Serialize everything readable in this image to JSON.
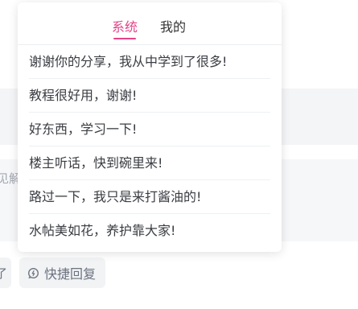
{
  "background": {
    "input_placeholder": "见解",
    "partial_button_label": "了",
    "quick_reply_label": "快捷回复"
  },
  "popup": {
    "tabs": [
      {
        "label": "系统",
        "active": true
      },
      {
        "label": "我的",
        "active": false
      }
    ],
    "replies": [
      "谢谢你的分享，我从中学到了很多!",
      "教程很好用，谢谢!",
      "好东西，学习一下!",
      "楼主听话，快到碗里来!",
      "路过一下，我只是来打酱油的!",
      "水帖美如花，养护靠大家!"
    ]
  },
  "colors": {
    "accent": "#e4438a",
    "text_primary": "#333333",
    "text_muted": "#6b7280",
    "panel_background": "#f6f7f9"
  }
}
